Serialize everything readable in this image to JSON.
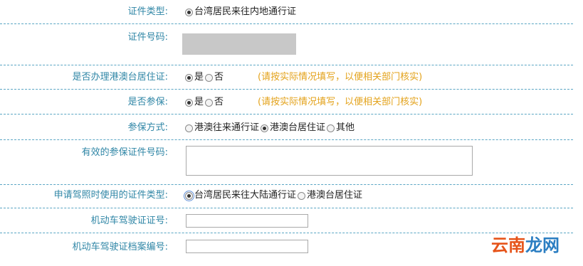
{
  "rows": {
    "id_type": {
      "label": "证件类型:",
      "options": [
        {
          "label": "台湾居民来往内地通行证",
          "selected": true
        }
      ]
    },
    "id_number": {
      "label": "证件号码:"
    },
    "hk_mo_residence": {
      "label": "是否办理港澳台居住证:",
      "options": [
        {
          "label": "是",
          "selected": true
        },
        {
          "label": "否",
          "selected": false
        }
      ],
      "note": "(请按实际情况填写，以便相关部门核实)"
    },
    "insured": {
      "label": "是否参保:",
      "options": [
        {
          "label": "是",
          "selected": true
        },
        {
          "label": "否",
          "selected": false
        }
      ],
      "note": "(请按实际情况填写，以便相关部门核实)"
    },
    "insurance_method": {
      "label": "参保方式:",
      "options": [
        {
          "label": "港澳往来通行证",
          "selected": false
        },
        {
          "label": "港澳台居住证",
          "selected": true
        },
        {
          "label": "其他",
          "selected": false
        }
      ]
    },
    "insurance_id_number": {
      "label": "有效的参保证件号码:",
      "value": ""
    },
    "license_id_type": {
      "label": "申请驾照时使用的证件类型:",
      "options": [
        {
          "label": "台湾居民来往大陆通行证",
          "selected": true
        },
        {
          "label": "港澳台居住证",
          "selected": false
        }
      ]
    },
    "vehicle_license_number": {
      "label": "机动车驾驶证证号:",
      "value": ""
    },
    "vehicle_license_file_number": {
      "label": "机动车驾驶证档案编号:",
      "value": ""
    }
  },
  "watermark": {
    "part1": "云南",
    "part2": "龙网"
  },
  "colors": {
    "label": "#2f86a6",
    "note": "#e3a21a",
    "separator": "#5aa6c4"
  }
}
